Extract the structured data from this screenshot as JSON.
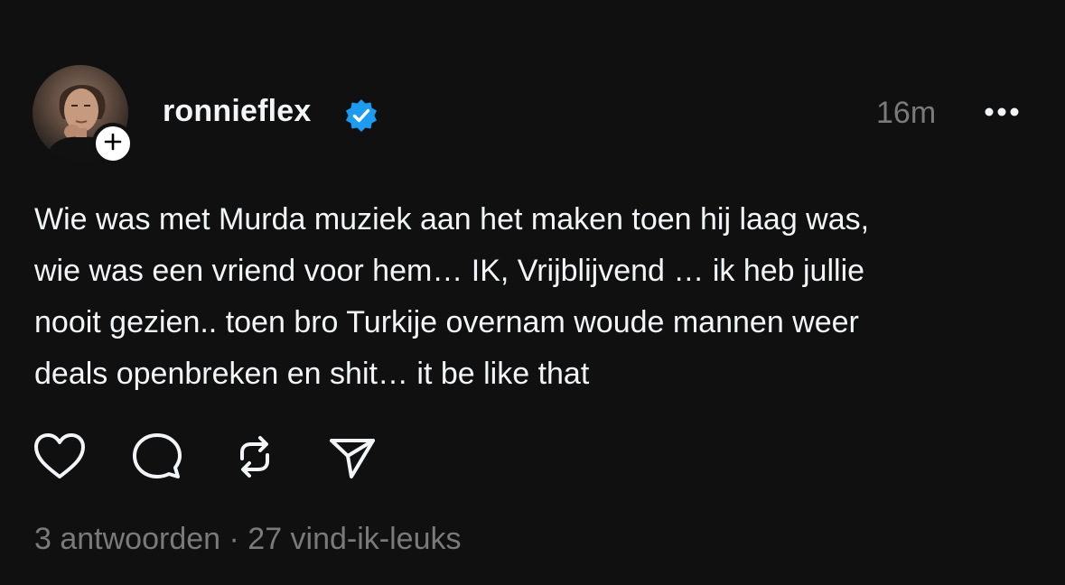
{
  "post": {
    "username": "ronnieflex",
    "verified": true,
    "time": "16m",
    "text_lines": [
      "Wie was met Murda muziek aan het maken toen hij laag was,",
      "wie was een vriend voor hem… IK, Vrijblijvend … ik heb jullie",
      "nooit gezien.. toen bro Turkije overnam woude mannen weer",
      "deals openbreken en shit… it be like that"
    ],
    "replies": "3 antwoorden",
    "separator": "·",
    "likes": "27 vind-ik-leuks"
  },
  "icons": {
    "follow": "plus-icon",
    "verified": "verified-badge-icon",
    "more": "more-options-icon",
    "like": "heart-icon",
    "reply": "comment-bubble-icon",
    "repost": "repost-icon",
    "share": "send-icon"
  },
  "colors": {
    "background": "#101010",
    "text": "#f3f5f7",
    "muted": "#7a7a7a",
    "verified": "#1d9bf0"
  }
}
